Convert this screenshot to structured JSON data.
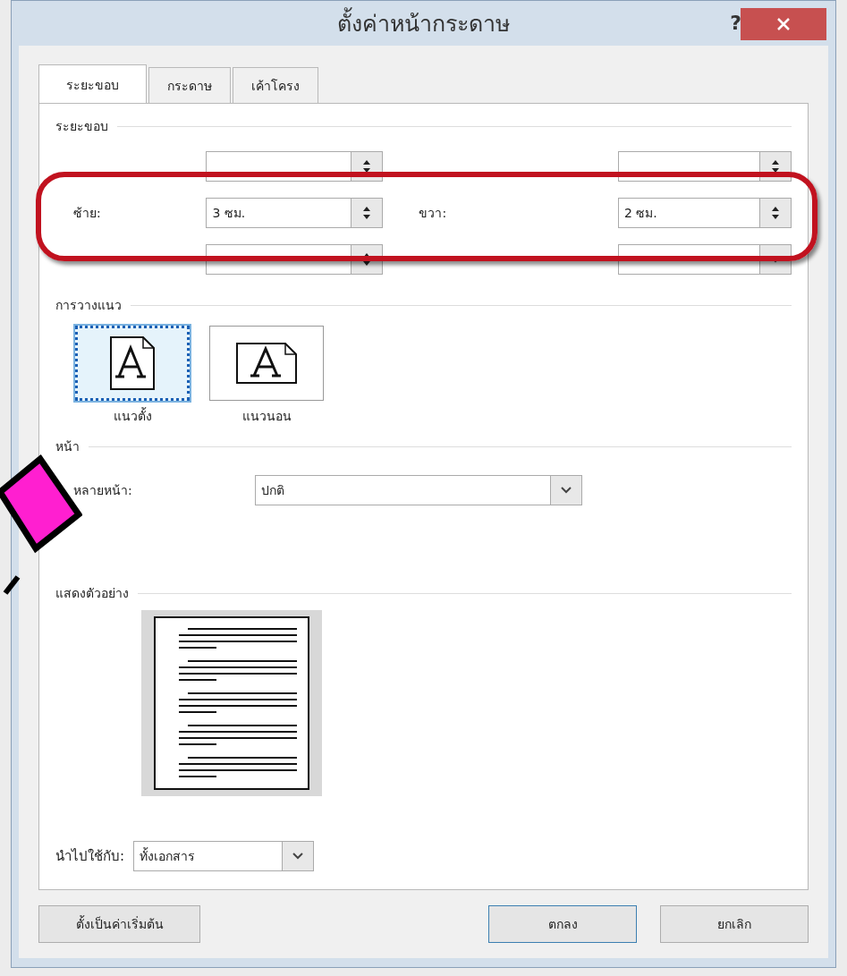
{
  "window": {
    "title": "ตั้งค่าหน้ากระดาษ",
    "help": "?"
  },
  "tabs": [
    {
      "label": "ระยะขอบ",
      "selected": true
    },
    {
      "label": "กระดาษ",
      "selected": false
    },
    {
      "label": "เค้าโครง",
      "selected": false
    }
  ],
  "margins": {
    "heading": "ระยะขอบ",
    "rows": [
      {
        "kind": "obscured_spin"
      },
      {
        "kind": "visible",
        "left_label": "ซ้าย:",
        "left_value": "3 ซม.",
        "right_label": "ขวา:",
        "right_value": "2 ซม."
      },
      {
        "kind": "obscured_dropdown"
      }
    ]
  },
  "orientation": {
    "heading": "การวางแนว",
    "options": [
      {
        "kind": "portrait",
        "label": "แนวตั้ง",
        "selected": true
      },
      {
        "kind": "landscape",
        "label": "แนวนอน",
        "selected": false
      }
    ]
  },
  "pages": {
    "heading": "หน้า",
    "label": "หลายหน้า:",
    "value": "ปกติ"
  },
  "preview": {
    "heading": "แสดงตัวอย่าง"
  },
  "apply": {
    "label": "นำไปใช้กับ:",
    "value": "ทั้งเอกสาร"
  },
  "buttons": [
    {
      "kind": "default",
      "label": "ตั้งเป็นค่าเริ่มต้น"
    },
    {
      "kind": "ok",
      "label": "ตกลง"
    },
    {
      "kind": "cancel",
      "label": "ยกเลิก"
    }
  ]
}
